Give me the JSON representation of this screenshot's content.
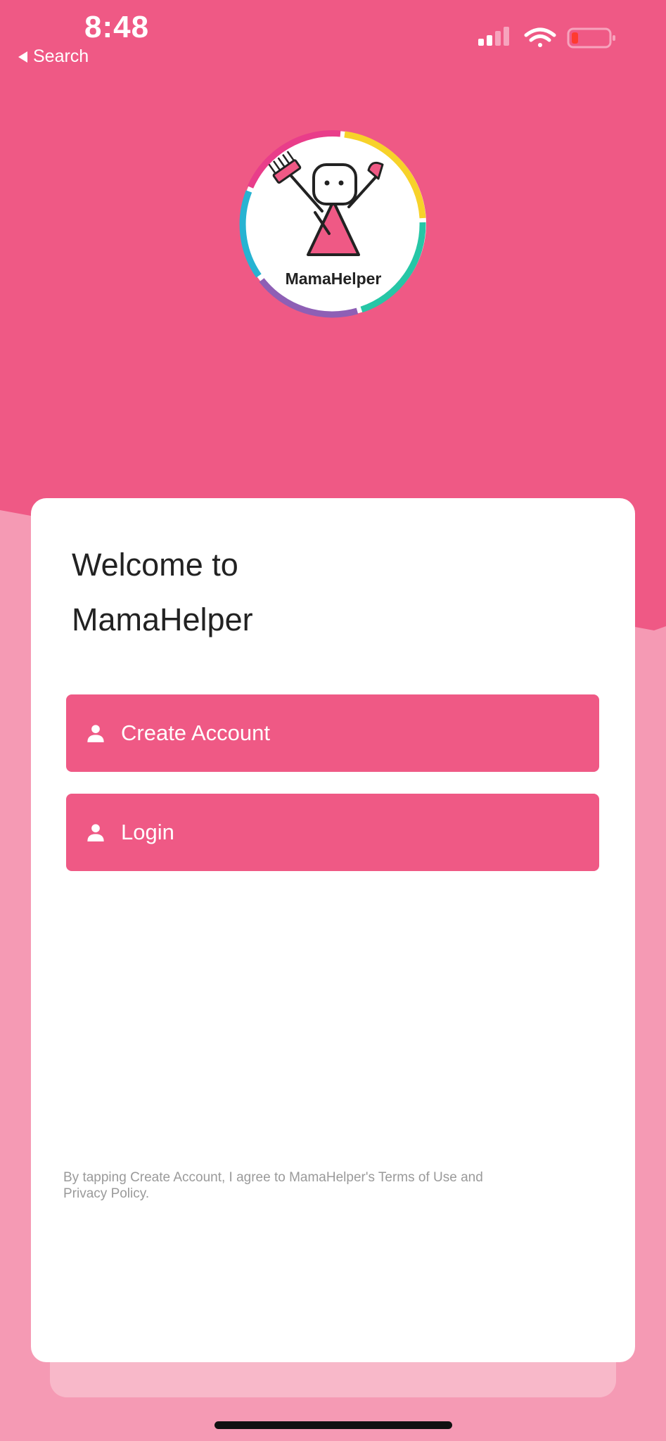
{
  "status_bar": {
    "time": "8:48",
    "back_label": "Search",
    "icons": [
      "cellular-signal-icon",
      "wifi-icon",
      "battery-icon"
    ]
  },
  "logo": {
    "text": "MamaHelper",
    "icon": "mama-helper-mascot-icon"
  },
  "welcome": {
    "line1": "Welcome to",
    "line2": "MamaHelper"
  },
  "buttons": {
    "create_account": "Create Account",
    "login": "Login"
  },
  "terms_text": "By tapping Create Account, I agree to MamaHelper's Terms of Use and Privacy Policy.",
  "colors": {
    "primary": "#ef5985",
    "header_bg": "#ef5985",
    "page_bg": "#f59ab4",
    "card_bg": "#ffffff"
  }
}
